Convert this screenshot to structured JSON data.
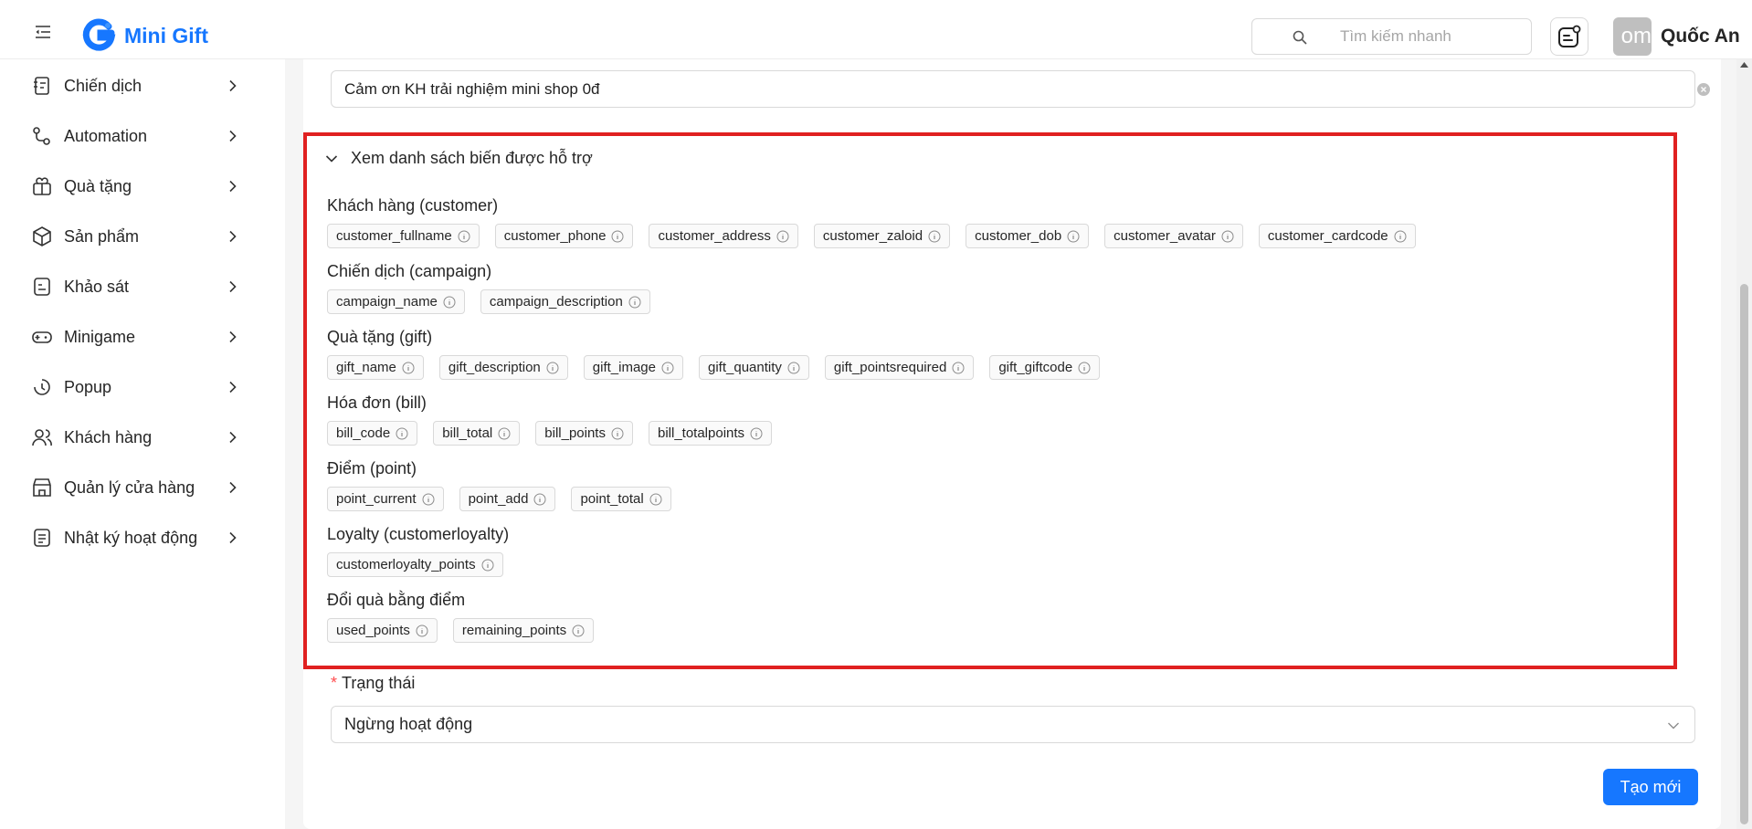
{
  "header": {
    "app_name": "Mini Gift",
    "search_placeholder": "Tìm kiếm nhanh",
    "avatar_text": "om",
    "user_name": "Quốc An"
  },
  "sidebar": {
    "items": [
      {
        "label": "Chiến dịch",
        "icon": "campaign-icon"
      },
      {
        "label": "Automation",
        "icon": "automation-icon"
      },
      {
        "label": "Quà tặng",
        "icon": "gift-icon"
      },
      {
        "label": "Sản phẩm",
        "icon": "product-box-icon"
      },
      {
        "label": "Khảo sát",
        "icon": "survey-icon"
      },
      {
        "label": "Minigame",
        "icon": "game-controller-icon"
      },
      {
        "label": "Popup",
        "icon": "popup-icon"
      },
      {
        "label": "Khách hàng",
        "icon": "customers-icon"
      },
      {
        "label": "Quản lý cửa hàng",
        "icon": "store-icon"
      },
      {
        "label": "Nhật ký hoạt động",
        "icon": "activity-log-icon"
      }
    ]
  },
  "form": {
    "title_value": "Cảm ơn KH trải nghiệm mini shop 0đ",
    "vars_toggle_label": "Xem danh sách biến được hỗ trợ",
    "groups": [
      {
        "title": "Khách hàng (customer)",
        "tags": [
          "customer_fullname",
          "customer_phone",
          "customer_address",
          "customer_zaloid",
          "customer_dob",
          "customer_avatar",
          "customer_cardcode"
        ]
      },
      {
        "title": "Chiến dịch (campaign)",
        "tags": [
          "campaign_name",
          "campaign_description"
        ]
      },
      {
        "title": "Quà tặng (gift)",
        "tags": [
          "gift_name",
          "gift_description",
          "gift_image",
          "gift_quantity",
          "gift_pointsrequired",
          "gift_giftcode"
        ]
      },
      {
        "title": "Hóa đơn (bill)",
        "tags": [
          "bill_code",
          "bill_total",
          "bill_points",
          "bill_totalpoints"
        ]
      },
      {
        "title": "Điểm (point)",
        "tags": [
          "point_current",
          "point_add",
          "point_total"
        ]
      },
      {
        "title": "Loyalty (customerloyalty)",
        "tags": [
          "customerloyalty_points"
        ]
      },
      {
        "title": "Đổi quà bằng điểm",
        "tags": [
          "used_points",
          "remaining_points"
        ]
      }
    ],
    "status_required_mark": "*",
    "status_label": "Trạng thái",
    "status_value": "Ngừng hoạt động",
    "create_label": "Tạo mới"
  },
  "colors": {
    "brand": "#1677ff",
    "highlight_border": "#e02020",
    "required": "#ff4d4f"
  }
}
